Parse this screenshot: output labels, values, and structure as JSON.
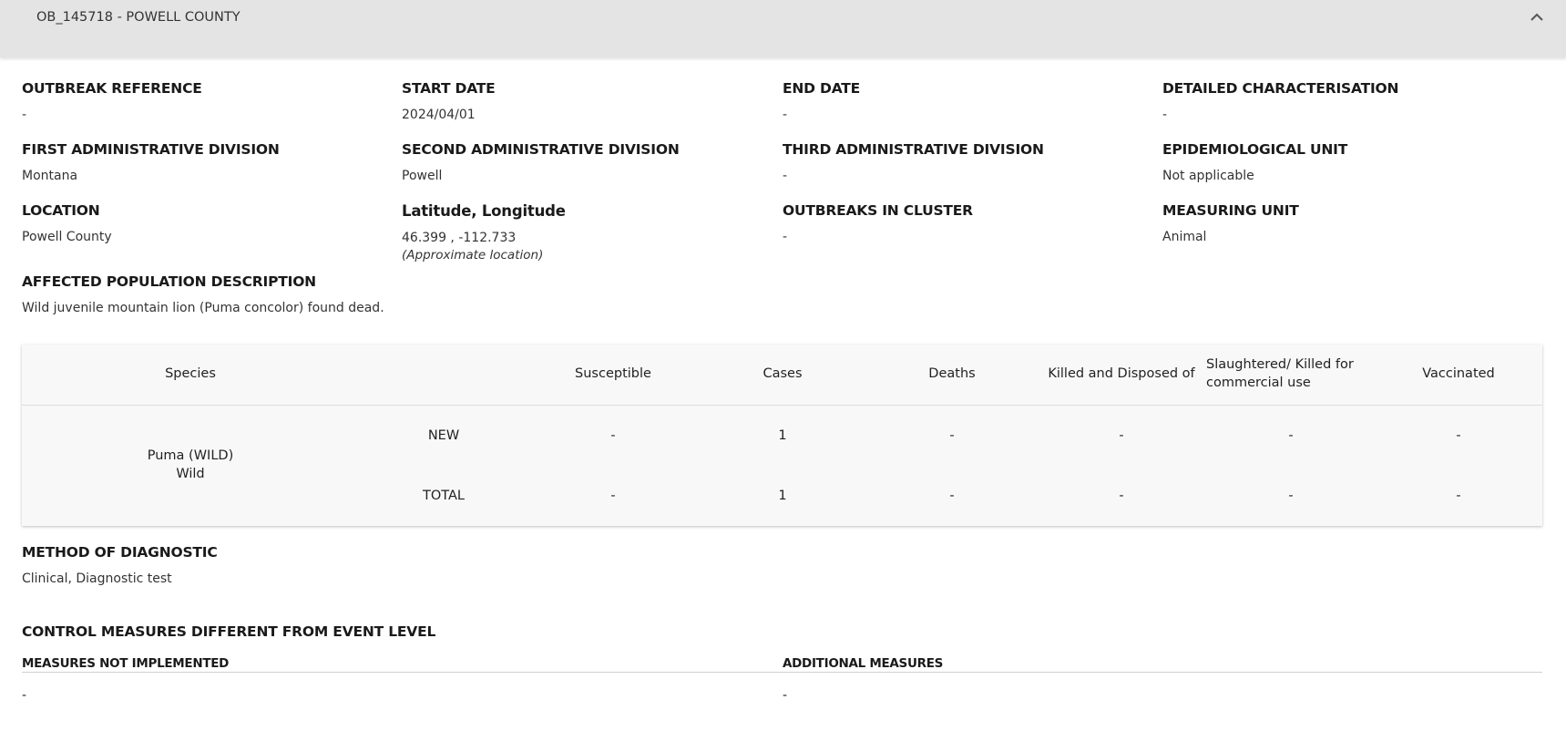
{
  "header": {
    "title": "OB_145718 - POWELL COUNTY",
    "collapse_icon": "chevron-up-icon"
  },
  "fields": {
    "outbreak_reference": {
      "label": "OUTBREAK REFERENCE",
      "value": "-"
    },
    "start_date": {
      "label": "START DATE",
      "value": "2024/04/01"
    },
    "end_date": {
      "label": "END DATE",
      "value": "-"
    },
    "detailed_characterisation": {
      "label": "DETAILED CHARACTERISATION",
      "value": "-"
    },
    "first_admin_division": {
      "label": "FIRST ADMINISTRATIVE DIVISION",
      "value": "Montana"
    },
    "second_admin_division": {
      "label": "SECOND ADMINISTRATIVE DIVISION",
      "value": "Powell"
    },
    "third_admin_division": {
      "label": "THIRD ADMINISTRATIVE DIVISION",
      "value": "-"
    },
    "epidemiological_unit": {
      "label": "EPIDEMIOLOGICAL UNIT",
      "value": "Not applicable"
    },
    "location": {
      "label": "LOCATION",
      "value": "Powell County"
    },
    "lat_long": {
      "label": "Latitude, Longitude",
      "value": "46.399 , -112.733",
      "note": "(Approximate location)"
    },
    "outbreaks_in_cluster": {
      "label": "OUTBREAKS IN CLUSTER",
      "value": "-"
    },
    "measuring_unit": {
      "label": "MEASURING UNIT",
      "value": "Animal"
    },
    "affected_population": {
      "label": "AFFECTED POPULATION DESCRIPTION",
      "value": "Wild juvenile mountain lion (Puma concolor) found dead."
    }
  },
  "species_table": {
    "columns": {
      "species": "Species",
      "susceptible": "Susceptible",
      "cases": "Cases",
      "deaths": "Deaths",
      "killed_disposed": "Killed and Disposed of",
      "slaughtered": "Slaughtered/ Killed for commercial use",
      "vaccinated": "Vaccinated"
    },
    "species_name": "Puma (WILD)",
    "species_type": "Wild",
    "rows": [
      {
        "label": "NEW",
        "susceptible": "-",
        "cases": "1",
        "deaths": "-",
        "killed_disposed": "-",
        "slaughtered": "-",
        "vaccinated": "-"
      },
      {
        "label": "TOTAL",
        "susceptible": "-",
        "cases": "1",
        "deaths": "-",
        "killed_disposed": "-",
        "slaughtered": "-",
        "vaccinated": "-"
      }
    ]
  },
  "method_of_diagnostic": {
    "label": "METHOD OF DIAGNOSTIC",
    "value": "Clinical, Diagnostic test"
  },
  "control_measures": {
    "title": "CONTROL MEASURES DIFFERENT FROM EVENT LEVEL",
    "not_implemented_label": "MEASURES NOT IMPLEMENTED",
    "not_implemented_value": "-",
    "additional_label": "ADDITIONAL MEASURES",
    "additional_value": "-"
  }
}
